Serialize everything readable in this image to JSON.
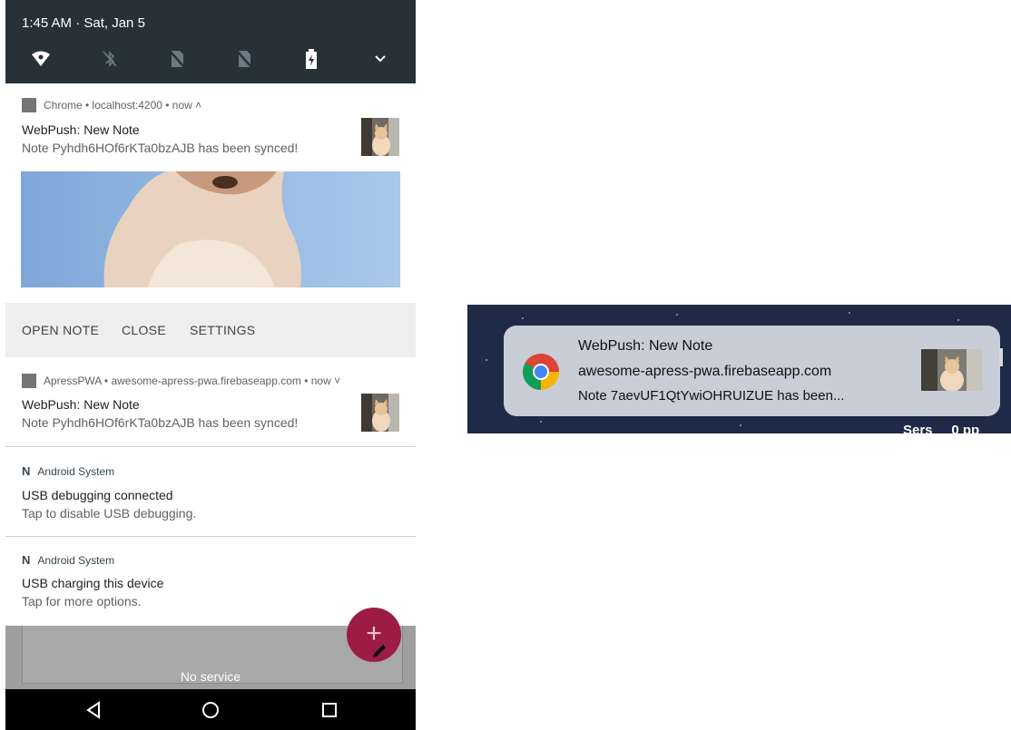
{
  "status_bar": {
    "time_date": "1:45 AM · Sat, Jan 5",
    "icons": [
      "wifi-icon",
      "bluetooth-off-icon",
      "no-sim-icon",
      "no-sim-icon",
      "battery-charging-icon",
      "expand-chevron-icon"
    ]
  },
  "chrome_notif": {
    "app_info": "Chrome • localhost:4200 • now ˄",
    "title": "WebPush: New Note",
    "text": "Note Pyhdh6HOf6rKTa0bzAJB has been synced!",
    "actions": [
      "OPEN NOTE",
      "CLOSE",
      "SETTINGS"
    ]
  },
  "pwa_notif": {
    "app_info": "ApressPWA • awesome-apress-pwa.firebaseapp.com • now ˅",
    "title": "WebPush: New Note",
    "text": "Note Pyhdh6HOf6rKTa0bzAJB has been synced!"
  },
  "usb_debug": {
    "app_name": "Android System",
    "title": "USB debugging connected",
    "text": "Tap to disable USB debugging."
  },
  "usb_charge": {
    "app_name": "Android System",
    "title": "USB charging this device",
    "text": "Tap for more options."
  },
  "background": {
    "no_service": "No service",
    "fab_symbol": "+"
  },
  "nav_icons": [
    "back-icon",
    "home-icon",
    "recents-icon"
  ],
  "mac_notif": {
    "title": "WebPush: New Note",
    "site": "awesome-apress-pwa.firebaseapp.com",
    "text": "Note 7aevUF1QtYwiOHRUIZUE has been...",
    "cut_text": "Sers     0 pp"
  },
  "colors": {
    "status_bar": "#263238",
    "fab": "#9c1c45",
    "mac_desktop": "#1f2a48",
    "mac_notif": "#c9cdd8"
  }
}
